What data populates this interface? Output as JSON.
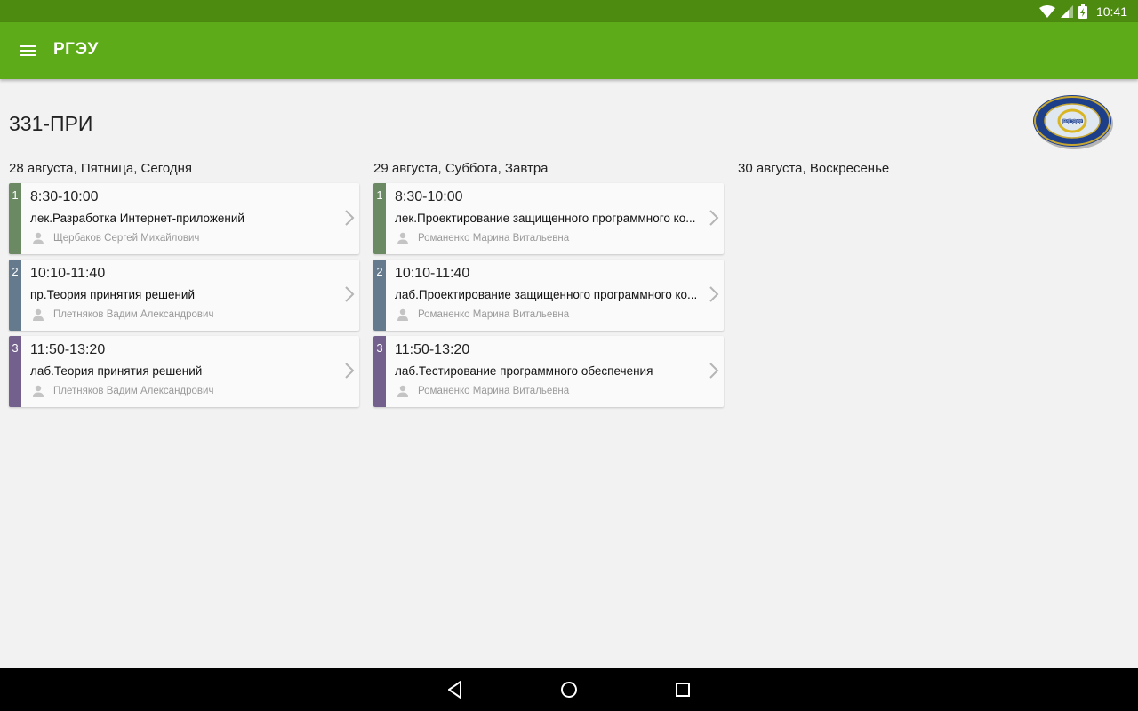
{
  "status": {
    "time": "10:41"
  },
  "appbar": {
    "title": "РГЭУ",
    "menu_icon": "hamburger-menu-icon"
  },
  "group": {
    "name": "331-ПРИ"
  },
  "logo": {
    "text": "РГЭУ",
    "ring_text": "РОСТОВСКИЙ ГОСУДАРСТВЕННЫЙ ЭКОНОМИЧЕСКИЙ УНИВЕРСИТЕТ (РИНХ)"
  },
  "days": [
    {
      "header": "28 августа, Пятница, Сегодня",
      "lessons": [
        {
          "number": "1",
          "time": "8:30-10:00",
          "subject": "лек.Разработка Интернет-приложений",
          "teacher": "Щербаков Сергей Михайлович",
          "color": "#6b8a64"
        },
        {
          "number": "2",
          "time": "10:10-11:40",
          "subject": "пр.Теория принятия решений",
          "teacher": "Плетняков Вадим Александрович",
          "color": "#667a8d"
        },
        {
          "number": "3",
          "time": "11:50-13:20",
          "subject": "лаб.Теория принятия решений",
          "teacher": "Плетняков Вадим Александрович",
          "color": "#74608c"
        }
      ]
    },
    {
      "header": "29 августа, Суббота, Завтра",
      "lessons": [
        {
          "number": "1",
          "time": "8:30-10:00",
          "subject": "лек.Проектирование защищенного программного ко...",
          "teacher": "Романенко Марина Витальевна",
          "color": "#6b8a64"
        },
        {
          "number": "2",
          "time": "10:10-11:40",
          "subject": "лаб.Проектирование защищенного программного ко...",
          "teacher": "Романенко Марина Витальевна",
          "color": "#667a8d"
        },
        {
          "number": "3",
          "time": "11:50-13:20",
          "subject": "лаб.Тестирование программного обеспечения",
          "teacher": "Романенко Марина Витальевна",
          "color": "#74608c"
        }
      ]
    },
    {
      "header": "30 августа, Воскресенье",
      "lessons": []
    }
  ],
  "navbar": {
    "back_icon": "back-icon",
    "home_icon": "home-icon",
    "recents_icon": "recents-icon"
  },
  "colors": {
    "statusbar": "#4d8a10",
    "appbar": "#5eab1a",
    "background": "#f2f2f2"
  }
}
